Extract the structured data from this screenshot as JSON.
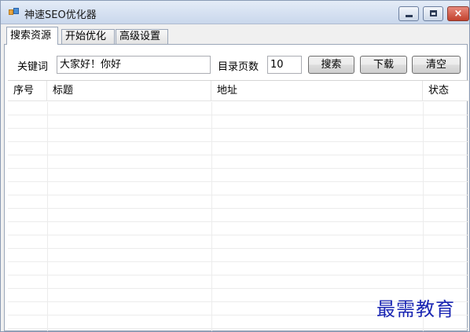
{
  "window": {
    "title": "神速SEO优化器"
  },
  "window_buttons": {
    "minimize": "minimize",
    "maximize": "maximize",
    "close": "×"
  },
  "tabs": [
    {
      "label": "搜索资源",
      "active": true
    },
    {
      "label": "开始优化",
      "active": false
    },
    {
      "label": "高级设置",
      "active": false
    }
  ],
  "search": {
    "keyword_label": "关键词",
    "keyword_value": "大家好！你好",
    "pages_label": "目录页数",
    "pages_value": "10",
    "search_button": "搜索",
    "download_button": "下载",
    "clear_button": "清空"
  },
  "table": {
    "columns": [
      "序号",
      "标题",
      "地址",
      "状态"
    ],
    "rows": []
  },
  "watermark": "最需教育",
  "colors": {
    "title_bar": "#c9d7ec",
    "close_button": "#c2412d",
    "watermark": "#1b27b3"
  }
}
